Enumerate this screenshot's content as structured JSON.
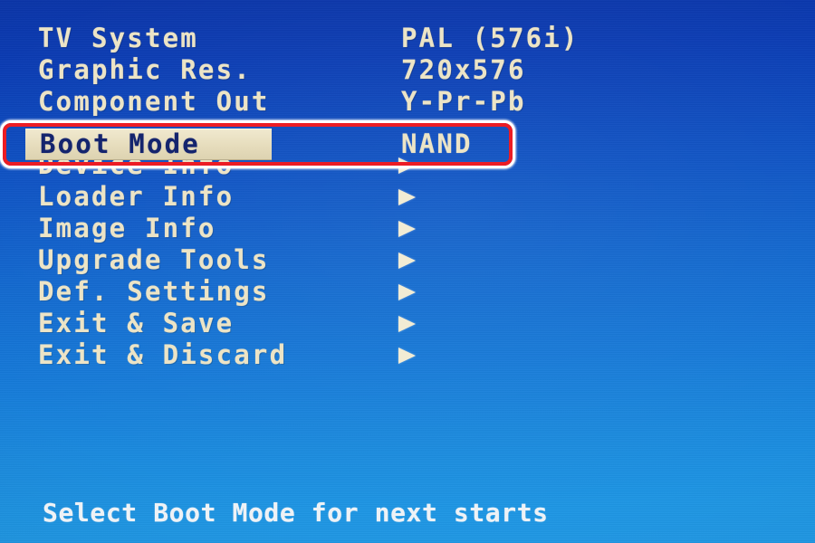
{
  "screen": {
    "kind": "set-top-box-bootloader-menu",
    "background_top_color": "#0a34a8",
    "background_bottom_color": "#2099e6",
    "text_color": "#ece4c6",
    "highlight_bg_color": "#e6dcbc",
    "highlight_text_color": "#14246e",
    "callout_color": "#ec1c24",
    "footer_text_color": "#eef2f6"
  },
  "menu": {
    "rows": [
      {
        "label": "TV System",
        "value": "PAL (576i)",
        "arrow": false,
        "selected": false
      },
      {
        "label": "Graphic Res.",
        "value": "720x576",
        "arrow": false,
        "selected": false
      },
      {
        "label": "Component Out",
        "value": "Y-Pr-Pb",
        "arrow": false,
        "selected": false
      },
      {
        "label": "Boot Mode",
        "value": "NAND",
        "arrow": false,
        "selected": true
      },
      {
        "label": "Device Info",
        "value": "",
        "arrow": true,
        "selected": false
      },
      {
        "label": "Loader Info",
        "value": "",
        "arrow": true,
        "selected": false
      },
      {
        "label": "Image Info",
        "value": "",
        "arrow": true,
        "selected": false
      },
      {
        "label": "Upgrade Tools",
        "value": "",
        "arrow": true,
        "selected": false
      },
      {
        "label": "Def. Settings",
        "value": "",
        "arrow": true,
        "selected": false
      },
      {
        "label": "Exit & Save",
        "value": "",
        "arrow": true,
        "selected": false
      },
      {
        "label": "Exit & Discard",
        "value": "",
        "arrow": true,
        "selected": false
      }
    ],
    "selected_index": 3,
    "selected_label": "Boot Mode",
    "selected_value": "NAND"
  },
  "footer": {
    "hint": "Select Boot Mode for next starts"
  }
}
